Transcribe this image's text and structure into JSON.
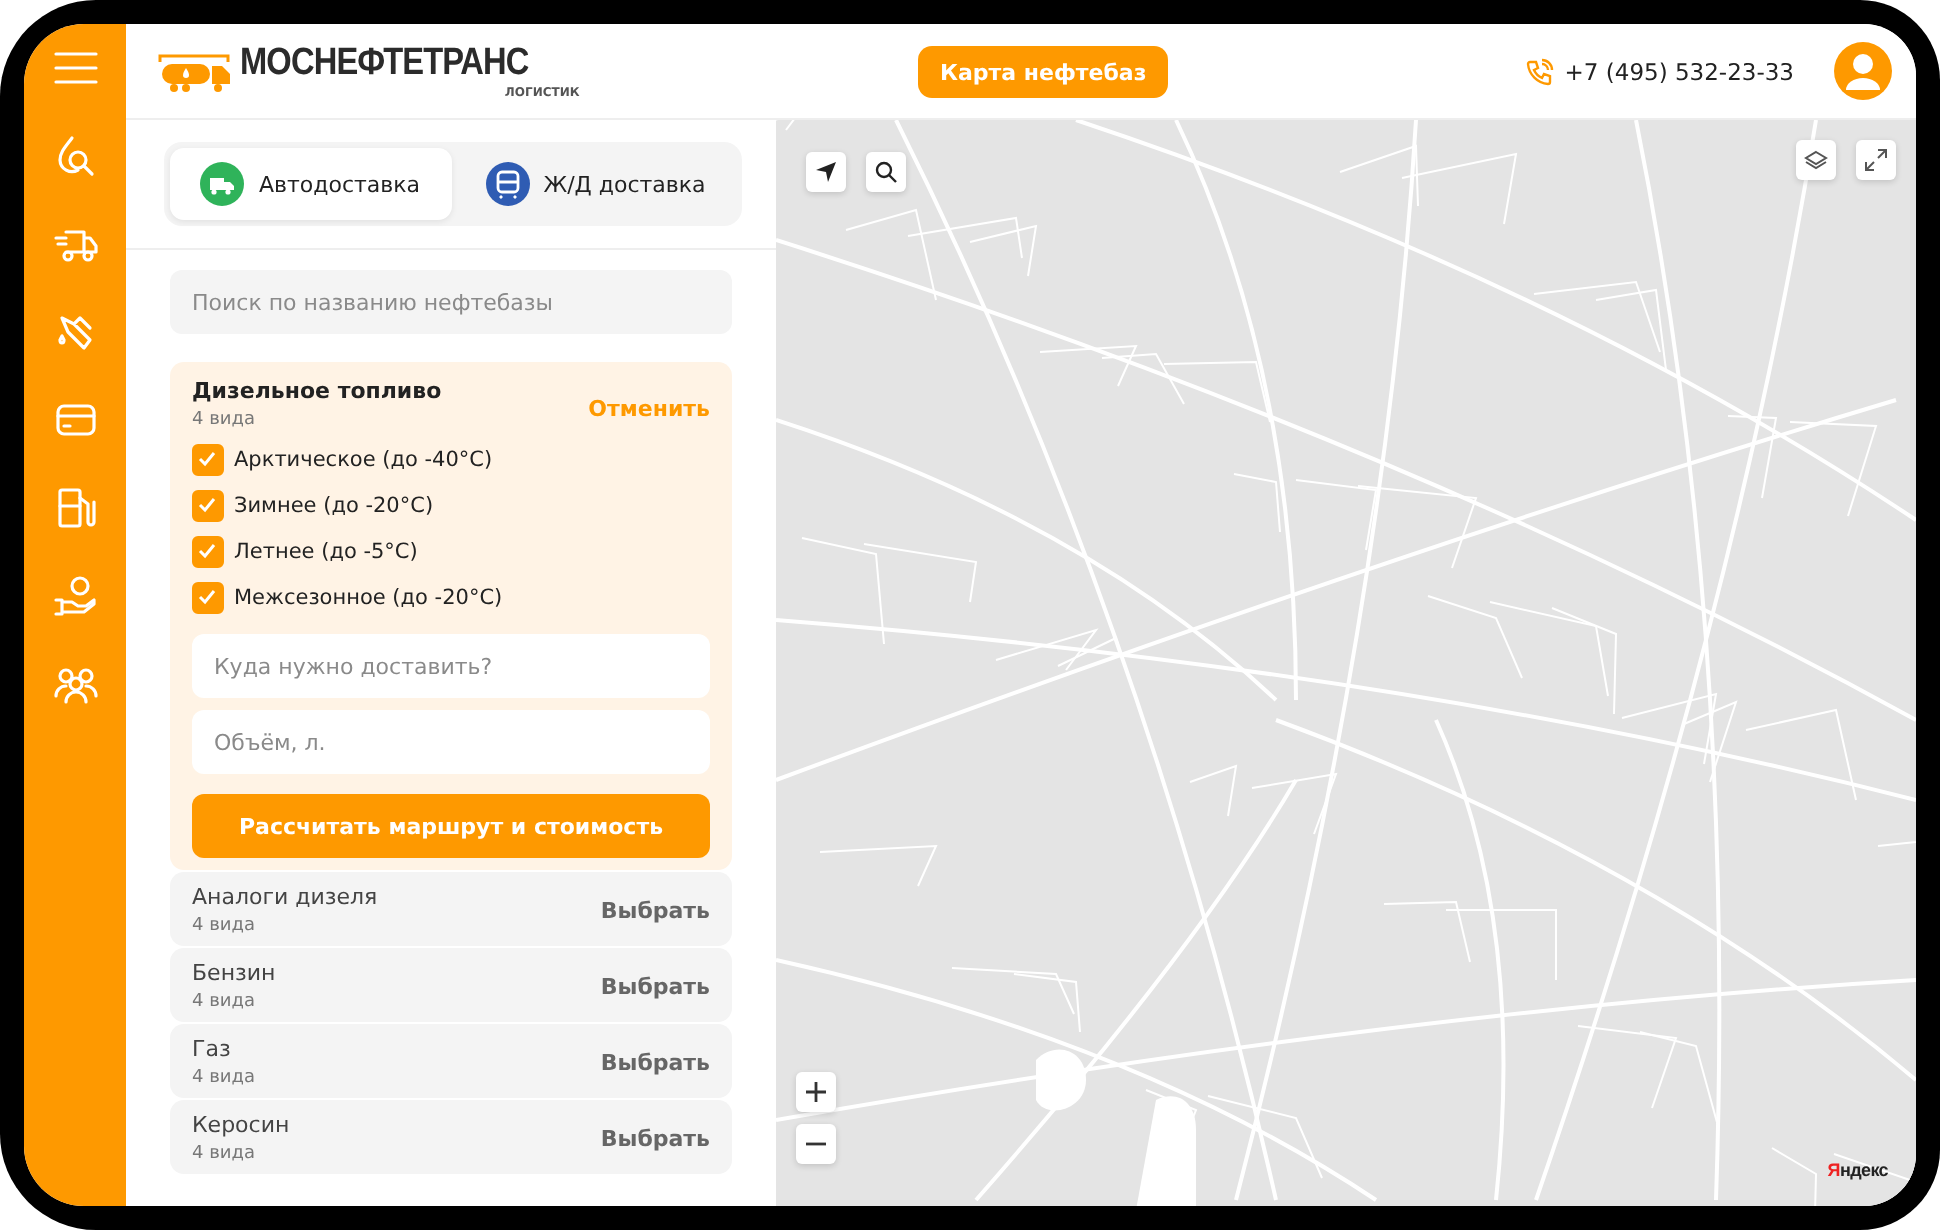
{
  "header": {
    "logo": {
      "title": "МОСНЕФТЕТРАНС",
      "subtitle": "ЛОГИСТИК"
    },
    "map_button": "Карта нефтебаз",
    "phone": "+7 (495) 532-23-33"
  },
  "delivery_tabs": [
    {
      "label": "Автодоставка",
      "kind": "truck",
      "selected": true
    },
    {
      "label": "Ж/Д доставка",
      "kind": "train",
      "selected": false
    }
  ],
  "search": {
    "placeholder": "Поиск по названию нефтебазы"
  },
  "fuel_groups": [
    {
      "name": "Дизельное топливо",
      "count": "4 вида",
      "action": "Отменить",
      "expanded": true,
      "options": [
        {
          "label": "Арктическое (до -40°C)",
          "checked": true
        },
        {
          "label": "Зимнее (до -20°C)",
          "checked": true
        },
        {
          "label": "Летнее (до -5°C)",
          "checked": true
        },
        {
          "label": "Межсезонное (до -20°C)",
          "checked": true
        }
      ],
      "address": {
        "placeholder": "Куда нужно доставить?"
      },
      "volume": {
        "placeholder": "Объём, л."
      },
      "submit": "Рассчитать маршрут и стоимость"
    },
    {
      "name": "Аналоги дизеля",
      "count": "4 вида",
      "action": "Выбрать",
      "expanded": false
    },
    {
      "name": "Бензин",
      "count": "4 вида",
      "action": "Выбрать",
      "expanded": false
    },
    {
      "name": "Газ",
      "count": "4 вида",
      "action": "Выбрать",
      "expanded": false
    },
    {
      "name": "Керосин",
      "count": "4 вида",
      "action": "Выбрать",
      "expanded": false
    }
  ],
  "map": {
    "attribution": "Яндекс"
  }
}
